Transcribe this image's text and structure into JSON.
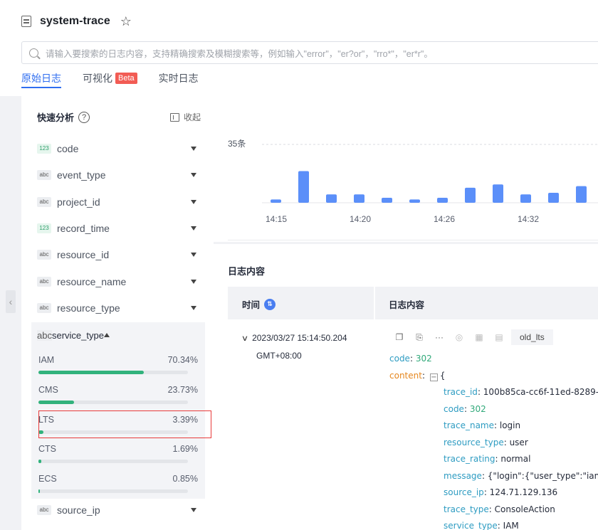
{
  "header": {
    "title": "system-trace",
    "search_placeholder": "请输入要搜索的日志内容，支持精确搜索及模糊搜索等，例如输入\"error\"，\"er?or\"，\"rro*\"，\"er*r\"。",
    "tabs": [
      {
        "label": "原始日志",
        "active": true
      },
      {
        "label": "可视化",
        "badge": "Beta"
      },
      {
        "label": "实时日志"
      }
    ]
  },
  "sidebar": {
    "title": "快速分析",
    "help_icon": "?",
    "collapse_label": "收起",
    "fields": [
      {
        "type": "123",
        "name": "code"
      },
      {
        "type": "abc",
        "name": "event_type"
      },
      {
        "type": "abc",
        "name": "project_id"
      },
      {
        "type": "123",
        "name": "record_time"
      },
      {
        "type": "abc",
        "name": "resource_id"
      },
      {
        "type": "abc",
        "name": "resource_name"
      },
      {
        "type": "abc",
        "name": "resource_type"
      },
      {
        "type": "abc",
        "name": "service_type"
      },
      {
        "type": "abc",
        "name": "source_ip"
      }
    ],
    "service_type_distribution": [
      {
        "label": "IAM",
        "percent": "70.34%",
        "value": 70.34
      },
      {
        "label": "CMS",
        "percent": "23.73%",
        "value": 23.73
      },
      {
        "label": "LTS",
        "percent": "3.39%",
        "value": 3.39
      },
      {
        "label": "CTS",
        "percent": "1.69%",
        "value": 1.69
      },
      {
        "label": "ECS",
        "percent": "0.85%",
        "value": 0.85
      }
    ]
  },
  "chart_data": {
    "type": "bar",
    "ymax_label": "35条",
    "ylim": [
      0,
      35
    ],
    "x_tick_labels": [
      "14:15",
      "14:20",
      "14:26",
      "14:32"
    ],
    "values": [
      2,
      19,
      5,
      5,
      3,
      2,
      3,
      9,
      11,
      5,
      6,
      10
    ],
    "color": "#5b8ff9"
  },
  "log": {
    "section_title": "日志内容",
    "col_time": "时间",
    "col_content": "日志内容",
    "time": "2023/03/27 15:14:50.204",
    "timezone": "GMT+08:00",
    "tag": "old_lts",
    "code_key": "code",
    "code_val": "302",
    "content_key": "content",
    "content_open": "{",
    "fields": [
      {
        "k": "trace_id",
        "v": "100b85ca-cc6f-11ed-8289-"
      },
      {
        "k": "code",
        "v": "302",
        "numeric": true
      },
      {
        "k": "trace_name",
        "v": "login"
      },
      {
        "k": "resource_type",
        "v": "user"
      },
      {
        "k": "trace_rating",
        "v": "normal"
      },
      {
        "k": "message",
        "v": "{\"login\":{\"user_type\":\"iam"
      },
      {
        "k": "source_ip",
        "v": "124.71.129.136"
      },
      {
        "k": "trace_type",
        "v": "ConsoleAction"
      },
      {
        "k": "service_type",
        "v": "IAM"
      }
    ]
  }
}
